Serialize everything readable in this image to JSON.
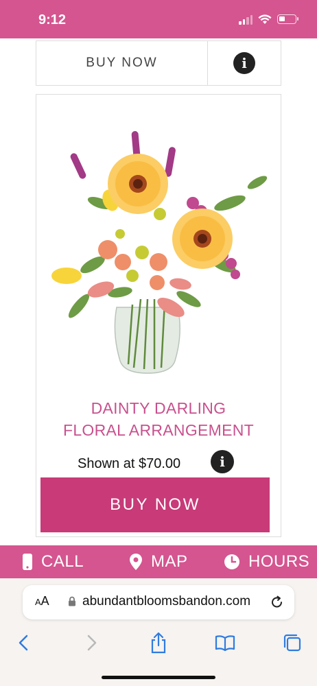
{
  "status_bar": {
    "time": "9:12"
  },
  "top_row": {
    "buy_label": "BUY NOW",
    "info_glyph": "i"
  },
  "product": {
    "title_line1": "DAINTY DARLING",
    "title_line2": "FLORAL ARRANGEMENT",
    "price_text": "Shown at $70.00",
    "info_glyph": "i",
    "buy_label": "BUY NOW"
  },
  "contact_bar": {
    "call_label": "CALL",
    "map_label": "MAP",
    "hours_label": "HOURS"
  },
  "browser": {
    "aa_big": "A",
    "aa_small": "A",
    "url": "abundantbloomsbandon.com"
  },
  "colors": {
    "brand_pink": "#d4558f",
    "button_pink": "#c83a78",
    "title_pink": "#c9508d"
  },
  "icons": [
    "signal-icon",
    "wifi-icon",
    "battery-icon",
    "info-icon",
    "phone-icon",
    "map-pin-icon",
    "clock-icon",
    "lock-icon",
    "reload-icon",
    "back-icon",
    "forward-icon",
    "share-icon",
    "bookmarks-icon",
    "tabs-icon"
  ]
}
